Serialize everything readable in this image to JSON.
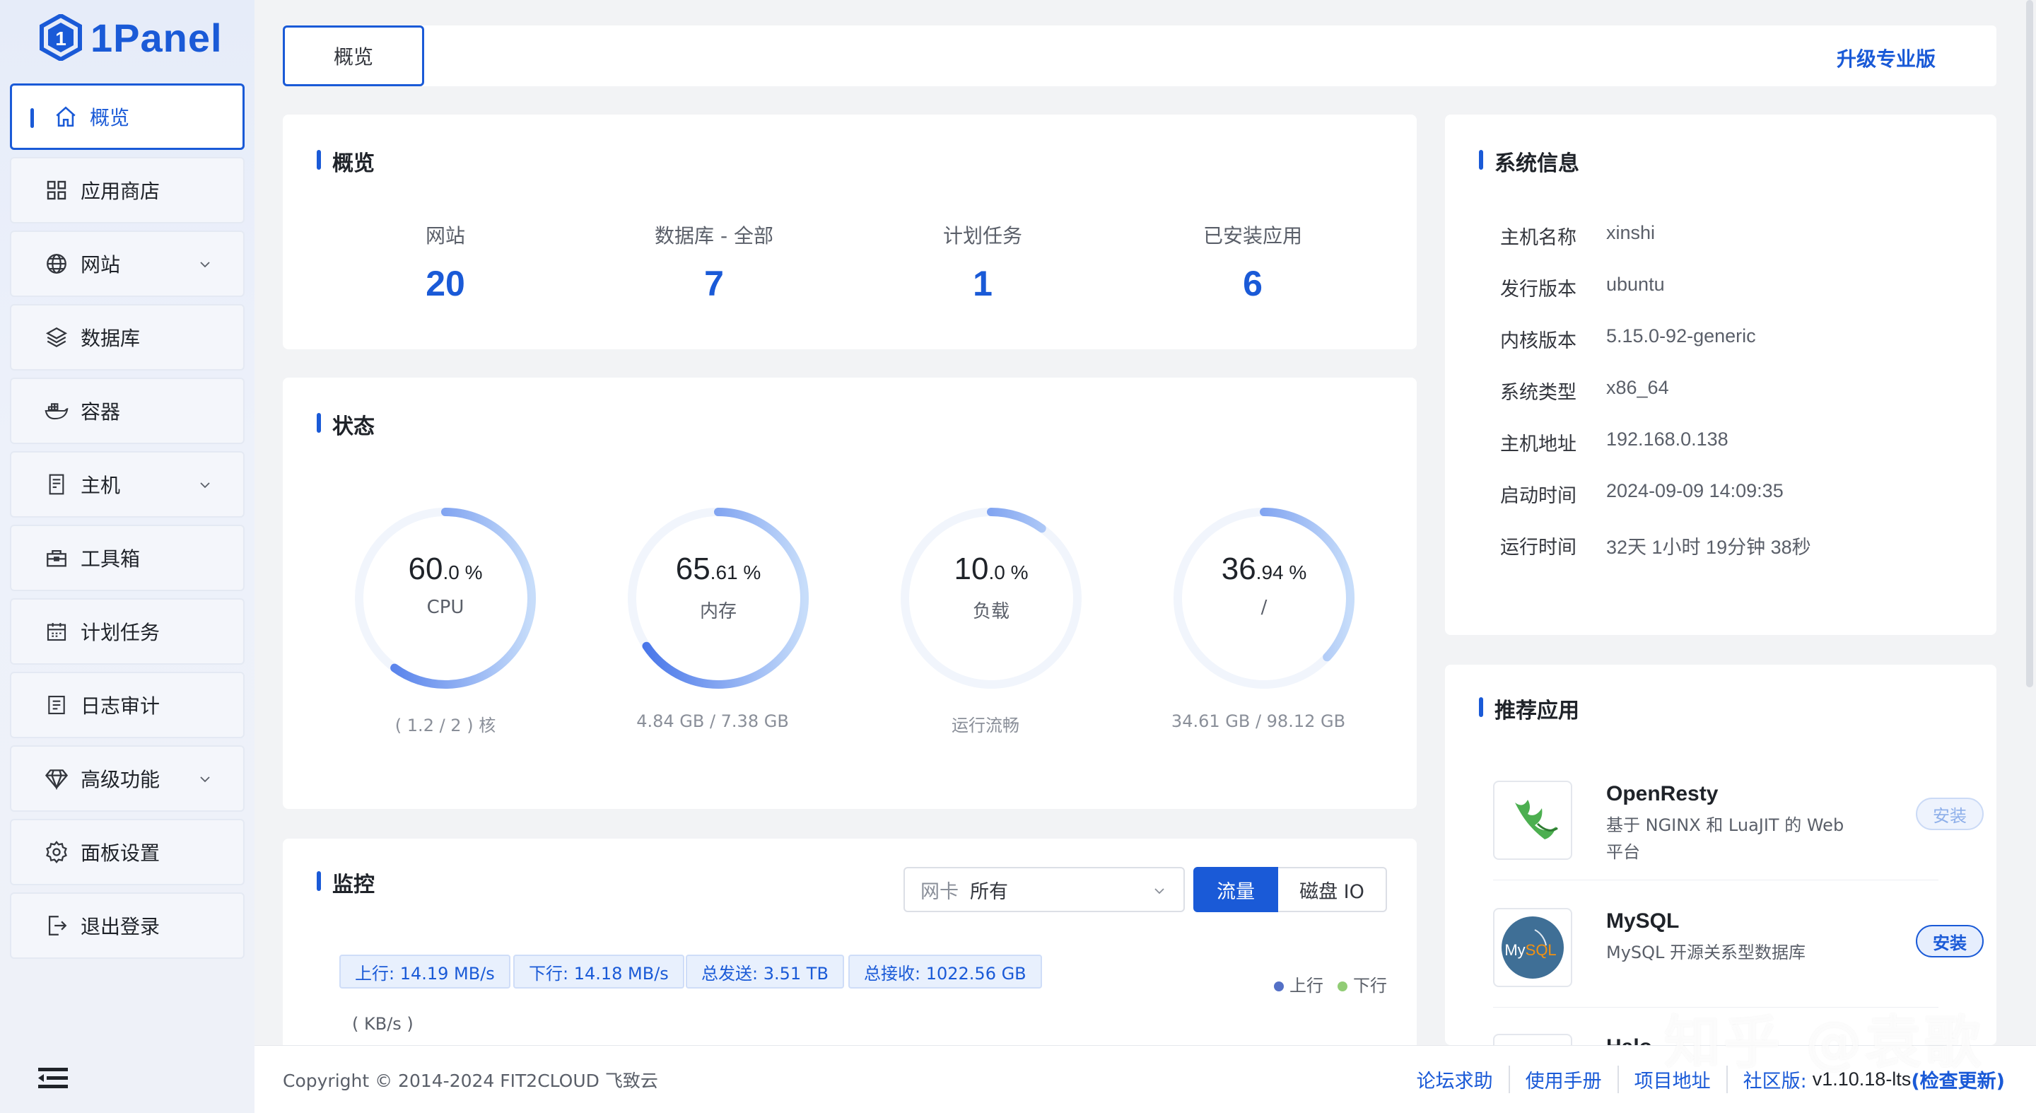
{
  "brand": {
    "name": "1Panel",
    "color": "#1a5ad7"
  },
  "sidebar": {
    "items": [
      {
        "label": "概览",
        "icon": "home-icon",
        "active": true
      },
      {
        "label": "应用商店",
        "icon": "grid-icon"
      },
      {
        "label": "网站",
        "icon": "globe-icon",
        "expandable": true
      },
      {
        "label": "数据库",
        "icon": "layers-icon"
      },
      {
        "label": "容器",
        "icon": "docker-icon"
      },
      {
        "label": "主机",
        "icon": "server-icon",
        "expandable": true
      },
      {
        "label": "工具箱",
        "icon": "toolbox-icon"
      },
      {
        "label": "计划任务",
        "icon": "calendar-icon"
      },
      {
        "label": "日志审计",
        "icon": "log-icon"
      },
      {
        "label": "高级功能",
        "icon": "diamond-icon",
        "expandable": true
      },
      {
        "label": "面板设置",
        "icon": "gear-icon"
      },
      {
        "label": "退出登录",
        "icon": "logout-icon"
      }
    ]
  },
  "topbar": {
    "tab": "概览",
    "upgrade": "升级专业版"
  },
  "overview": {
    "title": "概览",
    "stats": [
      {
        "label": "网站",
        "value": "20"
      },
      {
        "label": "数据库 - 全部",
        "value": "7"
      },
      {
        "label": "计划任务",
        "value": "1"
      },
      {
        "label": "已安装应用",
        "value": "6"
      }
    ]
  },
  "status": {
    "title": "状态",
    "gauges": [
      {
        "int": "60",
        "dec": ".0 %",
        "label": "CPU",
        "sub": "( 1.2 / 2 ) 核",
        "percent": 60.0
      },
      {
        "int": "65",
        "dec": ".61 %",
        "label": "内存",
        "sub": "4.84 GB / 7.38 GB",
        "percent": 65.61
      },
      {
        "int": "10",
        "dec": ".0 %",
        "label": "负载",
        "sub": "运行流畅",
        "percent": 10.0
      },
      {
        "int": "36",
        "dec": ".94 %",
        "label": "/",
        "sub": "34.61 GB / 98.12 GB",
        "percent": 36.94
      }
    ]
  },
  "monitor": {
    "title": "监控",
    "nic_prefix": "网卡",
    "nic_value": "所有",
    "seg_traffic": "流量",
    "seg_disk": "磁盘 IO",
    "chips": [
      "上行: 14.19 MB/s",
      "下行: 14.18 MB/s",
      "总发送: 3.51 TB",
      "总接收: 1022.56 GB"
    ],
    "legend_up": "上行",
    "legend_down": "下行",
    "unit": "( KB/s )",
    "colors": {
      "up": "#5470c6",
      "down": "#91cc75"
    }
  },
  "sysinfo": {
    "title": "系统信息",
    "rows": [
      {
        "key": "主机名称",
        "value": "xinshi"
      },
      {
        "key": "发行版本",
        "value": "ubuntu"
      },
      {
        "key": "内核版本",
        "value": "5.15.0-92-generic"
      },
      {
        "key": "系统类型",
        "value": "x86_64"
      },
      {
        "key": "主机地址",
        "value": "192.168.0.138"
      },
      {
        "key": "启动时间",
        "value": "2024-09-09 14:09:35"
      },
      {
        "key": "运行时间",
        "value": "32天 1小时 19分钟 38秒"
      }
    ]
  },
  "apps": {
    "title": "推荐应用",
    "items": [
      {
        "name": "OpenResty",
        "desc": "基于 NGINX 和 LuaJIT 的 Web 平台",
        "button": "安装",
        "installed": true
      },
      {
        "name": "MySQL",
        "desc": "MySQL 开源关系型数据库",
        "button": "安装",
        "installed": false
      },
      {
        "name": "Halo",
        "desc": "",
        "button": "",
        "installed": false
      }
    ]
  },
  "footer": {
    "copyright": "Copyright © 2014-2024 FIT2CLOUD 飞致云",
    "links": [
      "论坛求助",
      "使用手册",
      "项目地址",
      "社区版:"
    ],
    "version": "v1.10.18-lts",
    "check": "(检查更新)"
  },
  "watermark": "知乎 @袁歌"
}
